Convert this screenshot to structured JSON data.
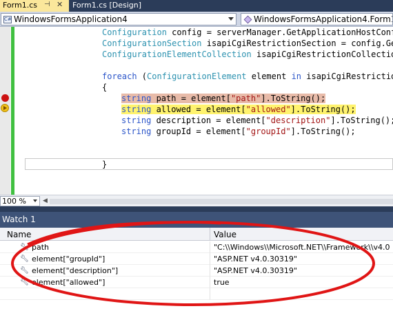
{
  "tabs": [
    {
      "label": "Form1.cs",
      "active": true
    },
    {
      "label": "Form1.cs [Design]",
      "active": false
    }
  ],
  "tab_icons": {
    "pin": "pin-icon",
    "close": "close-icon"
  },
  "nav": {
    "left_combo": "WindowsFormsApplication4",
    "right_combo": "WindowsFormsApplication4.Form1"
  },
  "code": {
    "line1": {
      "type": "Configuration",
      "rest": " config = serverManager.GetApplicationHostConfi"
    },
    "line2": {
      "type": "ConfigurationSection",
      "rest": " isapiCgiRestrictionSection = config.GetS"
    },
    "line3": {
      "type": "ConfigurationElementCollection",
      "rest": " isapiCgiRestrictionCollection"
    },
    "line4": {
      "kw": "foreach",
      "pre": " (",
      "type": "ConfigurationElement",
      "mid": " element ",
      "kw2": "in",
      "rest": " isapiCgiRestriction("
    },
    "line5": {
      "text": "{"
    },
    "line6": {
      "kw": "string",
      "pre": " path = element[",
      "str": "\"path\"",
      "rest": "].ToString();"
    },
    "line7": {
      "kw": "string",
      "pre": " allowed = element[",
      "str": "\"allowed\"",
      "rest": "].ToString();"
    },
    "line8": {
      "kw": "string",
      "pre": " description = element[",
      "str": "\"description\"",
      "rest": "].ToString();"
    },
    "line9": {
      "kw": "string",
      "pre": " groupId = element[",
      "str": "\"groupId\"",
      "rest": "].ToString();"
    },
    "line10": {
      "text": "}"
    }
  },
  "margin_markers": {
    "breakpoint": "breakpoint-icon",
    "current": "current-statement-arrow-icon"
  },
  "zoom": {
    "value": "100 %"
  },
  "watch": {
    "title": "Watch 1",
    "col_name": "Name",
    "col_value": "Value",
    "rows": [
      {
        "name": "path",
        "value": "\"C:\\\\Windows\\\\Microsoft.NET\\\\Framework\\\\v4.0"
      },
      {
        "name": "element[\"groupId\"]",
        "value": "\"ASP.NET v4.0.30319\""
      },
      {
        "name": "element[\"description\"]",
        "value": "\"ASP.NET v4.0.30319\""
      },
      {
        "name": "element[\"allowed\"]",
        "value": "true"
      },
      {
        "name": "",
        "value": ""
      }
    ],
    "row_icon": "wrench-icon"
  },
  "colors": {
    "breakpoint_highlight": "#e8bba9",
    "current_highlight": "#fff36e",
    "annotation_ellipse": "#e01515"
  }
}
